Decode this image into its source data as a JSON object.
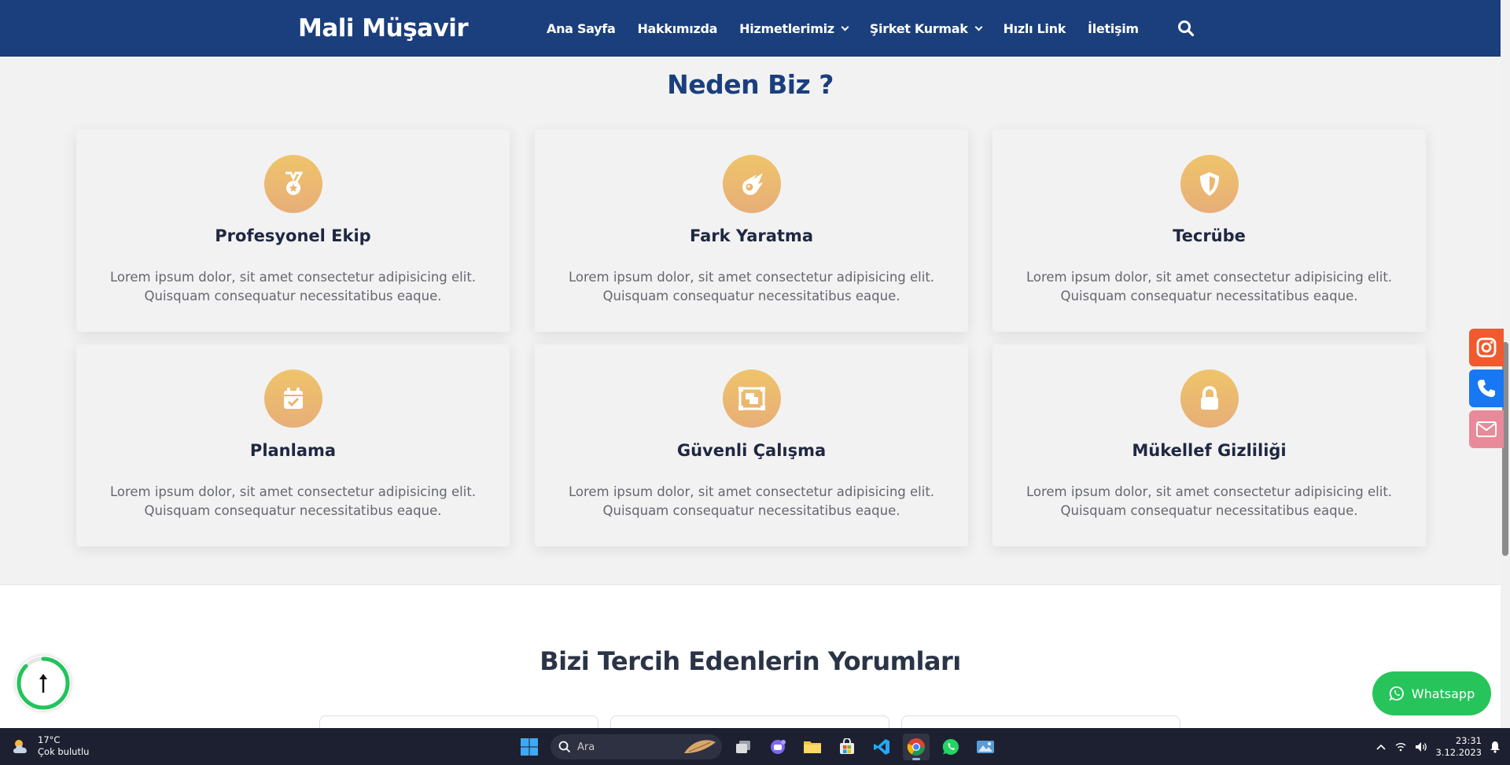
{
  "header": {
    "brand": "Mali Müşavir",
    "nav": [
      {
        "label": "Ana Sayfa",
        "dropdown": false
      },
      {
        "label": "Hakkımızda",
        "dropdown": false
      },
      {
        "label": "Hizmetlerimiz",
        "dropdown": true
      },
      {
        "label": "Şirket Kurmak",
        "dropdown": true
      },
      {
        "label": "Hızlı Link",
        "dropdown": false
      },
      {
        "label": "İletişim",
        "dropdown": false
      }
    ],
    "search_icon": "search-icon"
  },
  "why_us": {
    "title": "Neden Biz ?",
    "cards": [
      {
        "title": "Profesyonel Ekip",
        "icon": "medal-icon",
        "line1": "Lorem ipsum dolor, sit amet consectetur adipisicing elit.",
        "line2": "Quisquam consequatur necessitatibus eaque."
      },
      {
        "title": "Fark Yaratma",
        "icon": "meteor-icon",
        "line1": "Lorem ipsum dolor, sit amet consectetur adipisicing elit.",
        "line2": "Quisquam consequatur necessitatibus eaque."
      },
      {
        "title": "Tecrübe",
        "icon": "shield-icon",
        "line1": "Lorem ipsum dolor, sit amet consectetur adipisicing elit.",
        "line2": "Quisquam consequatur necessitatibus eaque."
      },
      {
        "title": "Planlama",
        "icon": "calendar-check-icon",
        "line1": "Lorem ipsum dolor, sit amet consectetur adipisicing elit.",
        "line2": "Quisquam consequatur necessitatibus eaque."
      },
      {
        "title": "Güvenli Çalışma",
        "icon": "object-group-icon",
        "line1": "Lorem ipsum dolor, sit amet consectetur adipisicing elit.",
        "line2": "Quisquam consequatur necessitatibus eaque."
      },
      {
        "title": "Mükellef Gizliliği",
        "icon": "lock-icon",
        "line1": "Lorem ipsum dolor, sit amet consectetur adipisicing elit.",
        "line2": "Quisquam consequatur necessitatibus eaque."
      }
    ]
  },
  "reviews": {
    "title": "Bizi Tercih Edenlerin Yorumları"
  },
  "side_social": [
    {
      "name": "instagram",
      "icon": "instagram-icon",
      "color": "#ef5a2e"
    },
    {
      "name": "phone",
      "icon": "phone-icon",
      "color": "#1877f2"
    },
    {
      "name": "email",
      "icon": "mail-icon",
      "color": "#e88a9a"
    }
  ],
  "floating": {
    "whatsapp_label": "Whatsapp",
    "whatsapp_color": "#27c45b",
    "scroll_top_icon": "arrow-up-icon",
    "scroll_progress_color": "#21c45a"
  },
  "taskbar": {
    "weather_temp": "17°C",
    "weather_desc": "Çok bulutlu",
    "search_placeholder": "Ara",
    "time": "23:31",
    "date": "3.12.2023",
    "apps": [
      "start-icon",
      "task-view-icon",
      "teams-icon",
      "file-explorer-icon",
      "store-icon",
      "vscode-icon",
      "chrome-icon",
      "whatsapp-icon",
      "photos-icon"
    ],
    "active_app": "chrome-icon"
  },
  "colors": {
    "primary": "#1b3f7d",
    "accent_gold": "#efc46a",
    "section_bg": "#f2f2f2"
  }
}
